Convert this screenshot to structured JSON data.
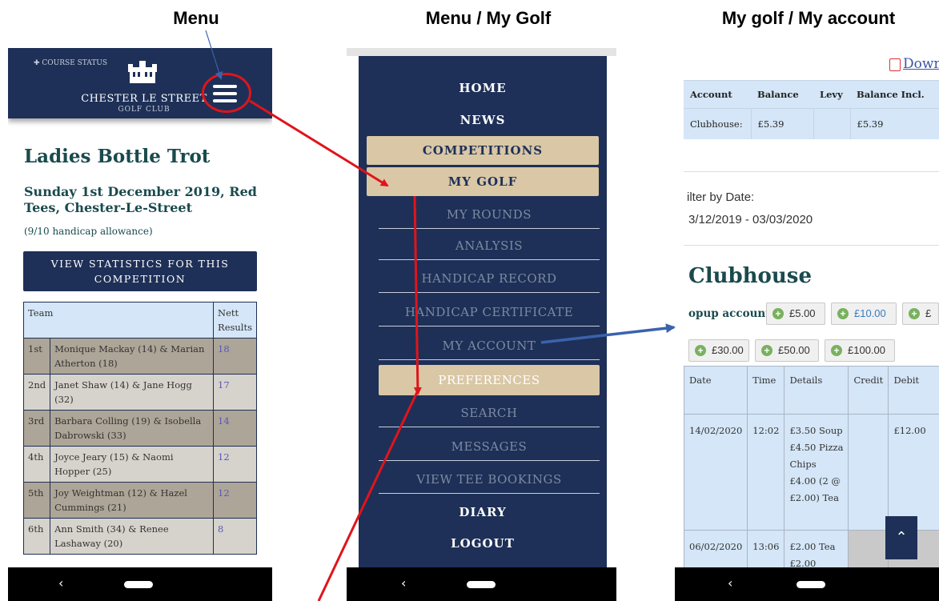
{
  "captions": {
    "left": "Menu",
    "middle": "Menu / My Golf",
    "right": "My golf / My account"
  },
  "panel1": {
    "header": {
      "course_status": "✚ COURSE STATUS",
      "club_name": "CHESTER LE STREET",
      "club_sub": "GOLF CLUB",
      "menu_icon": "hamburger-icon"
    },
    "competition": {
      "title": "Ladies Bottle Trot",
      "subtitle": "Sunday 1st December 2019, Red Tees, Chester-Le-Street",
      "note": "(9/10 handicap allowance)",
      "stats_button": "VIEW STATISTICS FOR THIS COMPETITION"
    },
    "results": {
      "headers": [
        "Team",
        "Nett Results"
      ],
      "rows": [
        {
          "pos": "1st",
          "team": "Monique Mackay (14) & Marian Atherton (18)",
          "pts": "18"
        },
        {
          "pos": "2nd",
          "team": "Janet Shaw (14) & Jane Hogg (32)",
          "pts": "17"
        },
        {
          "pos": "3rd",
          "team": "Barbara Colling (19) & Isobella Dabrowski (33)",
          "pts": "14"
        },
        {
          "pos": "4th",
          "team": "Joyce Jeary (15) & Naomi Hopper (25)",
          "pts": "12"
        },
        {
          "pos": "5th",
          "team": "Joy Weightman (12) & Hazel Cummings (21)",
          "pts": "12"
        },
        {
          "pos": "6th",
          "team": "Ann Smith (34) & Renee Lashaway (20)",
          "pts": "8"
        }
      ]
    }
  },
  "panel2": {
    "menu": {
      "home": "HOME",
      "news": "NEWS",
      "competitions": "COMPETITIONS",
      "my_golf": "MY GOLF",
      "my_rounds": "MY ROUNDS",
      "analysis": "ANALYSIS",
      "handicap_record": "HANDICAP RECORD",
      "handicap_certificate": "HANDICAP CERTIFICATE",
      "my_account": "MY ACCOUNT",
      "preferences": "PREFERENCES",
      "search": "SEARCH",
      "messages": "MESSAGES",
      "view_tee_bookings": "VIEW TEE BOOKINGS",
      "diary": "DIARY",
      "logout": "LOGOUT"
    }
  },
  "panel3": {
    "download_link": "Downl",
    "account_table": {
      "headers": [
        "Account",
        "Balance",
        "Levy",
        "Balance Incl."
      ],
      "row": [
        "Clubhouse:",
        "£5.39",
        "",
        "£5.39"
      ]
    },
    "filter_label": "ilter by Date:",
    "filter_value": "3/12/2019 - 03/03/2020",
    "section_title": "Clubhouse",
    "topup_label": "opup account:",
    "topup_options": [
      "£5.00",
      "£10.00",
      "£",
      "£30.00",
      "£50.00",
      "£100.00"
    ],
    "transactions": {
      "headers": [
        "Date",
        "Time",
        "Details",
        "Credit",
        "Debit"
      ],
      "rows": [
        {
          "date": "14/02/2020",
          "time": "12:02",
          "details": "£3.50 Soup £4.50 Pizza Chips £4.00 (2 @ £2.00) Tea",
          "credit": "",
          "debit": "£12.00"
        },
        {
          "date": "06/02/2020",
          "time": "13:06",
          "details": "£2.00 Tea £2.00",
          "credit": "",
          "debit": ""
        }
      ]
    },
    "scroll_top_icon": "chevron-up-icon"
  },
  "navbar": {
    "back_glyph": "‹"
  },
  "colors": {
    "navy": "#1e3057",
    "tan": "#d9c7a6",
    "teal_text": "#1a4a4d",
    "annotation_red": "#e0141b",
    "annotation_blue": "#3a63ad"
  }
}
